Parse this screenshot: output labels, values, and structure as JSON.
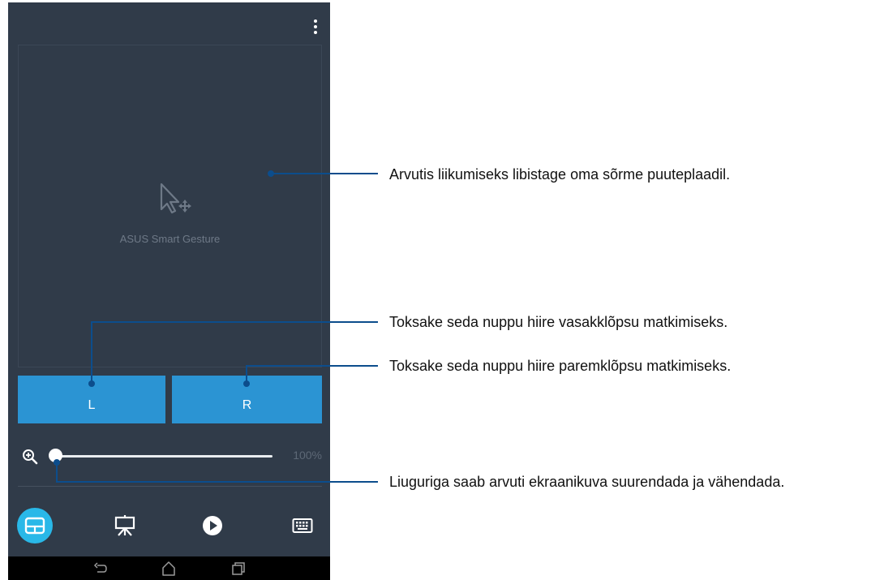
{
  "app": {
    "brand_name": "ASUS Smart Gesture",
    "left_button_label": "L",
    "right_button_label": "R",
    "zoom_value": "100%",
    "zoom_fraction": 0.0
  },
  "tabs": [
    {
      "name": "touchpad",
      "icon": "touchpad-icon",
      "active": true
    },
    {
      "name": "presentation",
      "icon": "presentation-icon",
      "active": false
    },
    {
      "name": "media",
      "icon": "play-icon",
      "active": false
    },
    {
      "name": "keyboard",
      "icon": "keyboard-icon",
      "active": false
    }
  ],
  "callouts": {
    "touchpad": "Arvutis liikumiseks libistage oma sõrme puuteplaadil.",
    "left_button": "Toksake seda nuppu hiire vasakklõpsu matkimiseks.",
    "right_button": "Toksake seda nuppu hiire paremklõpsu matkimiseks.",
    "zoom_slider": "Liuguriga saab arvuti ekraanikuva suurendada ja vähendada."
  },
  "colors": {
    "app_background": "#303b49",
    "button_blue": "#2b94d3",
    "active_tab": "#29b8e8",
    "callout_line": "#0c4d8c"
  }
}
